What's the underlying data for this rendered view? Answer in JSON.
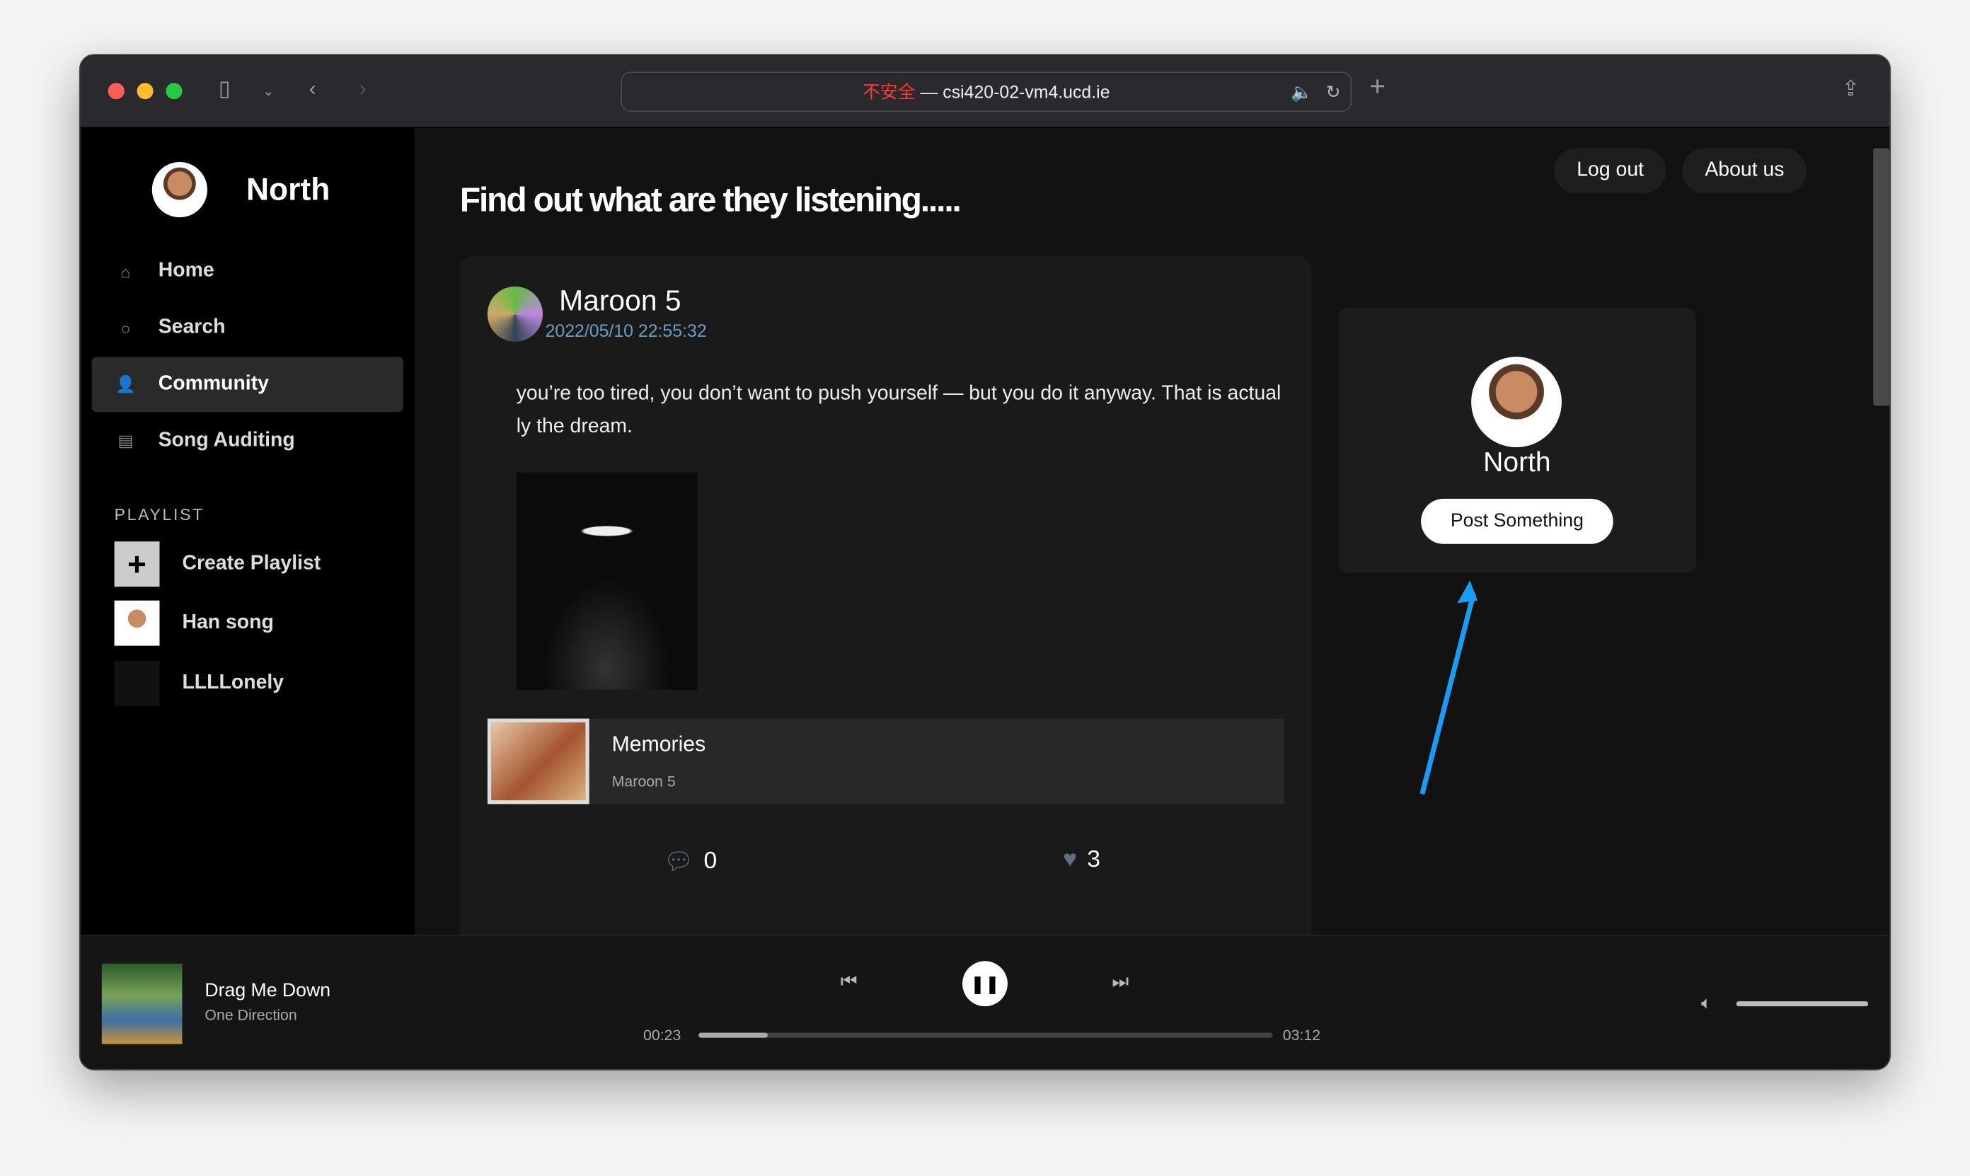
{
  "browser": {
    "insecure_label": "不安全",
    "separator": " — ",
    "url": "csi420-02-vm4.ucd.ie"
  },
  "sidebar": {
    "brand": "North",
    "nav": [
      {
        "label": "Home",
        "icon": "home-icon"
      },
      {
        "label": "Search",
        "icon": "search-icon"
      },
      {
        "label": "Community",
        "icon": "community-icon",
        "active": true
      },
      {
        "label": "Song Auditing",
        "icon": "clipboard-icon"
      }
    ],
    "playlist_heading": "PLAYLIST",
    "playlists": [
      {
        "label": "Create Playlist"
      },
      {
        "label": "Han song"
      },
      {
        "label": "LLLLonely"
      }
    ]
  },
  "header": {
    "title": "Find out what are they listening.....",
    "logout": "Log out",
    "about": "About us"
  },
  "post": {
    "author": "Maroon 5",
    "time": "2022/05/10 22:55:32",
    "text": "you’re too tired, you don’t want to push yourself — but you do it anyway. That is actually the dream.",
    "song_title": "Memories",
    "song_artist": "Maroon 5",
    "comments": "0",
    "likes": "3"
  },
  "profile": {
    "name": "North",
    "post_button": "Post Something"
  },
  "player": {
    "title": "Drag Me Down",
    "artist": "One Direction",
    "elapsed": "00:23",
    "duration": "03:12",
    "progress": 0.12,
    "volume": 1.0
  }
}
